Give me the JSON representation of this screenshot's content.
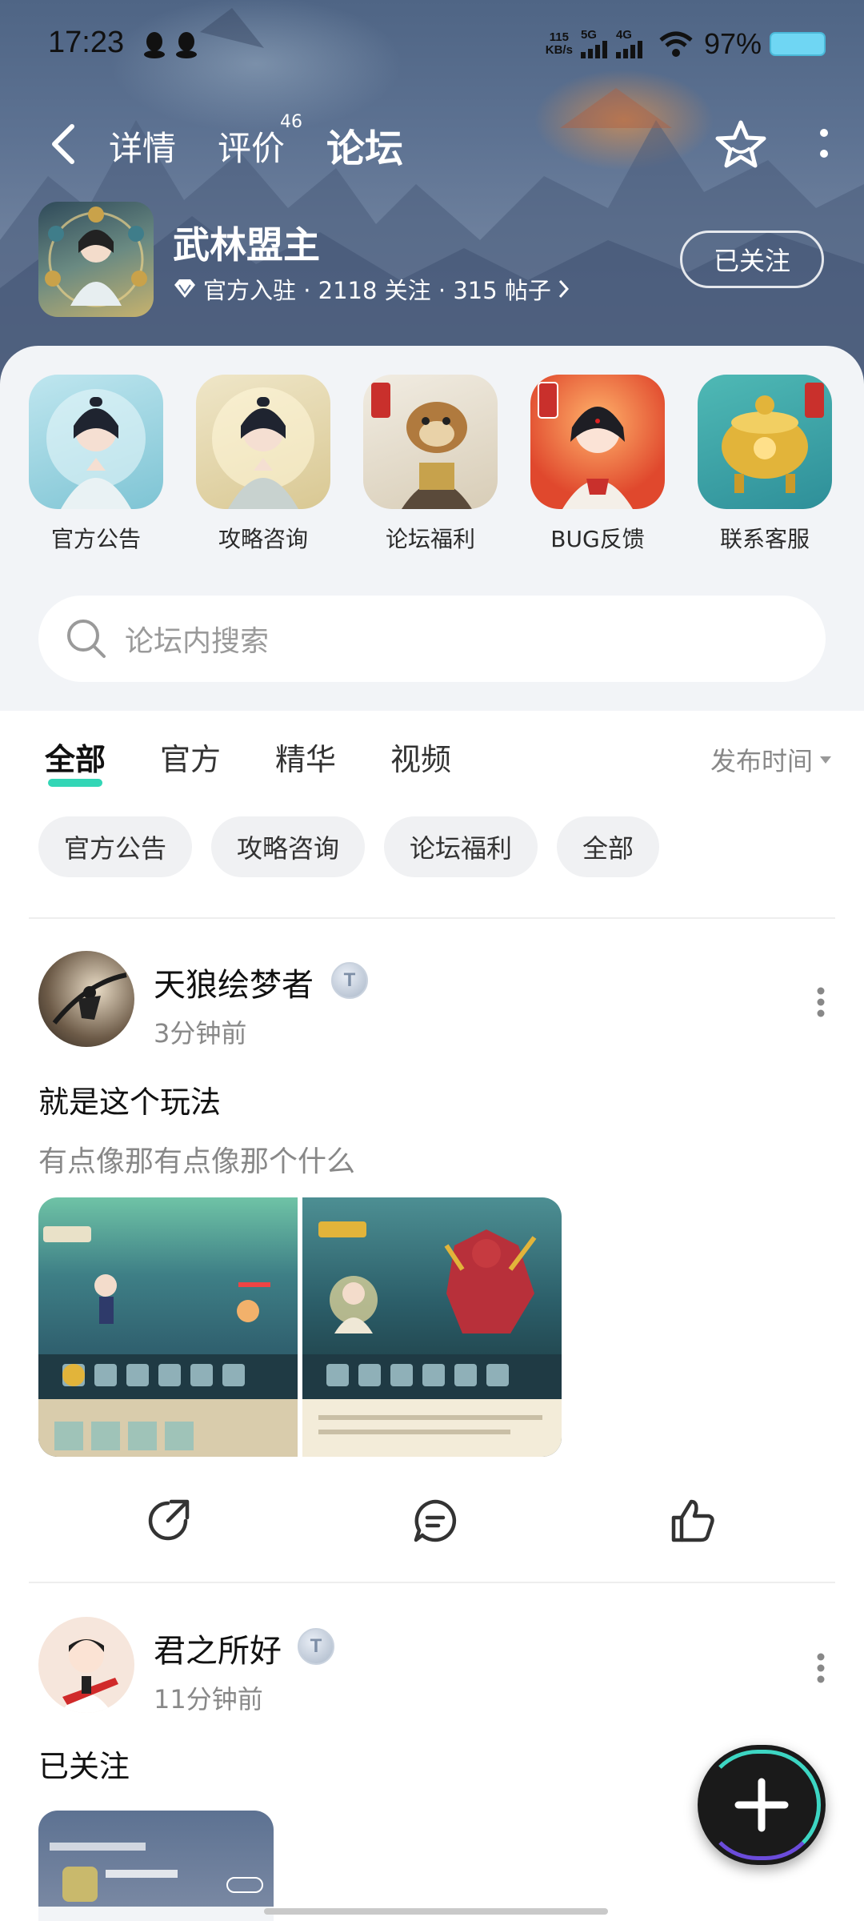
{
  "status_bar": {
    "time": "17:23",
    "net_speed_value": "115",
    "net_speed_unit": "KB/s",
    "sim1": "5G",
    "sim2": "4G",
    "battery": "97%"
  },
  "nav": {
    "tabs": [
      {
        "label": "详情"
      },
      {
        "label": "评价",
        "badge": "46"
      },
      {
        "label": "论坛"
      }
    ]
  },
  "forum": {
    "name": "武林盟主",
    "meta": "官方入驻 · 2118 关注 · 315 帖子",
    "follow_label": "已关注"
  },
  "categories": [
    {
      "label": "官方公告"
    },
    {
      "label": "攻略咨询"
    },
    {
      "label": "论坛福利"
    },
    {
      "label": "BUG反馈"
    },
    {
      "label": "联系客服"
    }
  ],
  "search": {
    "placeholder": "论坛内搜索"
  },
  "filter_tabs": [
    {
      "label": "全部"
    },
    {
      "label": "官方"
    },
    {
      "label": "精华"
    },
    {
      "label": "视频"
    }
  ],
  "sort_label": "发布时间",
  "chips": [
    {
      "label": "官方公告"
    },
    {
      "label": "攻略咨询"
    },
    {
      "label": "论坛福利"
    },
    {
      "label": "全部"
    }
  ],
  "posts": [
    {
      "author": "天狼绘梦者",
      "level": "T",
      "time": "3分钟前",
      "title": "就是这个玩法",
      "body": "有点像那有点像那个什么"
    },
    {
      "author": "君之所好",
      "level": "T",
      "time": "11分钟前",
      "title": "已关注"
    }
  ],
  "colors": {
    "accent": "#33d6b6",
    "header_bg": "#5d7292"
  }
}
